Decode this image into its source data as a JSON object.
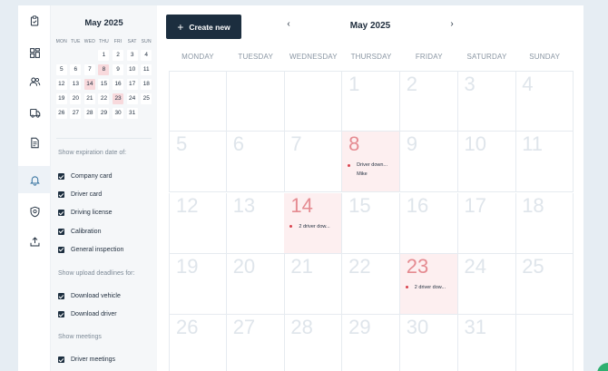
{
  "theme": {
    "accent": "#1c2e3f",
    "event_bg": "#fdeff0",
    "event_dot": "#d9434e",
    "help": "#2fb070"
  },
  "rail": {
    "items": [
      {
        "icon": "clipboard-icon",
        "active": false
      },
      {
        "icon": "dashboard-grid-icon",
        "active": false
      },
      {
        "icon": "users-icon",
        "active": false
      },
      {
        "icon": "truck-icon",
        "active": false
      },
      {
        "icon": "document-icon",
        "active": false
      },
      {
        "icon": "bell-icon",
        "active": true
      },
      {
        "icon": "shield-icon",
        "active": false
      },
      {
        "icon": "upload-icon",
        "active": false
      }
    ]
  },
  "mini_calendar": {
    "title": "May 2025",
    "weekdays": [
      "MON",
      "TUE",
      "WED",
      "THU",
      "FRI",
      "SAT",
      "SUN"
    ],
    "days": [
      "",
      "",
      "",
      "1",
      "2",
      "3",
      "4",
      "5",
      "6",
      "7",
      "8",
      "9",
      "10",
      "11",
      "12",
      "13",
      "14",
      "15",
      "16",
      "17",
      "18",
      "19",
      "20",
      "21",
      "22",
      "23",
      "24",
      "25",
      "26",
      "27",
      "28",
      "29",
      "30",
      "31",
      ""
    ],
    "marked": [
      "8",
      "14",
      "23"
    ]
  },
  "filters": {
    "expiration_title": "Show expiration date of:",
    "expiration": [
      "Company card",
      "Driver card",
      "Driving license",
      "Calibration",
      "General inspection"
    ],
    "upload_title": "Show upload deadlines for:",
    "upload": [
      "Download vehicle",
      "Download driver"
    ],
    "meetings_title": "Show meetings",
    "meetings": [
      "Driver meetings"
    ]
  },
  "toolbar": {
    "create_label": "Create new",
    "prev": "‹",
    "next": "›",
    "month_title": "May 2025"
  },
  "calendar": {
    "weekdays": [
      "MONDAY",
      "TUESDAY",
      "WEDNESDAY",
      "THURSDAY",
      "FRIDAY",
      "SATURDAY",
      "SUNDAY"
    ],
    "weeks": [
      [
        "",
        "",
        "",
        "1",
        "2",
        "3",
        "4"
      ],
      [
        "5",
        "6",
        "7",
        "8",
        "9",
        "10",
        "11"
      ],
      [
        "12",
        "13",
        "14",
        "15",
        "16",
        "17",
        "18"
      ],
      [
        "19",
        "20",
        "21",
        "22",
        "23",
        "24",
        "25"
      ],
      [
        "26",
        "27",
        "28",
        "29",
        "30",
        "31",
        ""
      ]
    ],
    "events": {
      "8": {
        "title": "Driver down...",
        "sub": "Mike"
      },
      "14": {
        "title": "2 driver dow..."
      },
      "23": {
        "title": "2 driver dow..."
      }
    }
  }
}
